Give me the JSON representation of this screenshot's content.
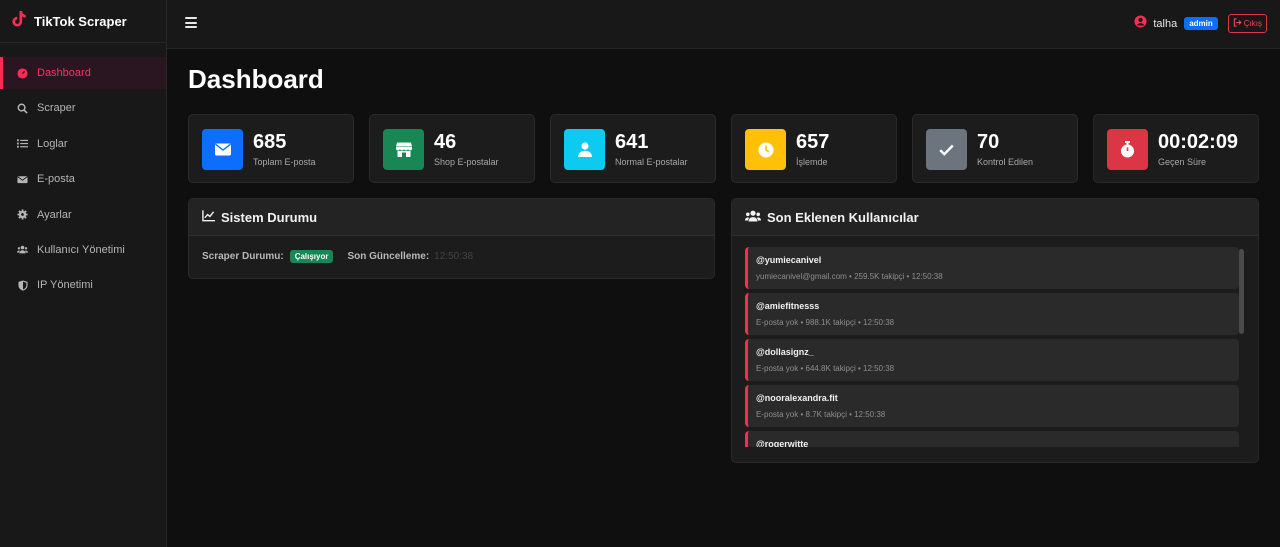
{
  "brand": {
    "name": "TikTok Scraper"
  },
  "sidebar": {
    "items": [
      {
        "label": "Dashboard",
        "icon": "gauge-icon",
        "active": true
      },
      {
        "label": "Scraper",
        "icon": "search-icon"
      },
      {
        "label": "Loglar",
        "icon": "list-icon"
      },
      {
        "label": "E-posta",
        "icon": "envelope-icon"
      },
      {
        "label": "Ayarlar",
        "icon": "gear-icon"
      },
      {
        "label": "Kullanıcı Yönetimi",
        "icon": "users-icon"
      },
      {
        "label": "IP Yönetimi",
        "icon": "shield-icon"
      }
    ]
  },
  "topbar": {
    "user_name": "talha",
    "role_badge": "admin",
    "logout_label": "Çıkış"
  },
  "page": {
    "title": "Dashboard"
  },
  "stats": [
    {
      "value": "685",
      "label": "Toplam E-posta",
      "color": "#0d6efd",
      "icon": "envelope-icon"
    },
    {
      "value": "46",
      "label": "Shop E-postalar",
      "color": "#198754",
      "icon": "store-icon"
    },
    {
      "value": "641",
      "label": "Normal E-postalar",
      "color": "#0dcaf0",
      "icon": "user-icon"
    },
    {
      "value": "657",
      "label": "İşlemde",
      "color": "#ffc107",
      "icon": "clock-icon"
    },
    {
      "value": "70",
      "label": "Kontrol Edilen",
      "color": "#6c757d",
      "icon": "check-icon"
    },
    {
      "value": "00:02:09",
      "label": "Geçen Süre",
      "color": "#dc3545",
      "icon": "stopwatch-icon"
    }
  ],
  "system_status": {
    "title": "Sistem Durumu",
    "scraper_label": "Scraper Durumu:",
    "scraper_status": "Çalışıyor",
    "last_update_label": "Son Güncelleme:",
    "last_update_value": "12:50:38"
  },
  "recent_users": {
    "title": "Son Eklenen Kullanıcılar",
    "items": [
      {
        "handle": "@yumiecanivel",
        "meta": "yumiecanivel@gmail.com • 259.5K takipçi • 12:50:38"
      },
      {
        "handle": "@amiefitnesss",
        "meta": "E-posta yok • 988.1K takipçi • 12:50:38"
      },
      {
        "handle": "@dollasignz_",
        "meta": "E-posta yok • 644.8K takipçi • 12:50:38"
      },
      {
        "handle": "@nooralexandra.fit",
        "meta": "E-posta yok • 8.7K takipçi • 12:50:38"
      },
      {
        "handle": "@rogerwitte",
        "meta": ""
      }
    ]
  },
  "colors": {
    "accent": "#fe2c55",
    "background": "#0f0f0f",
    "panel": "#1c1c1c"
  }
}
